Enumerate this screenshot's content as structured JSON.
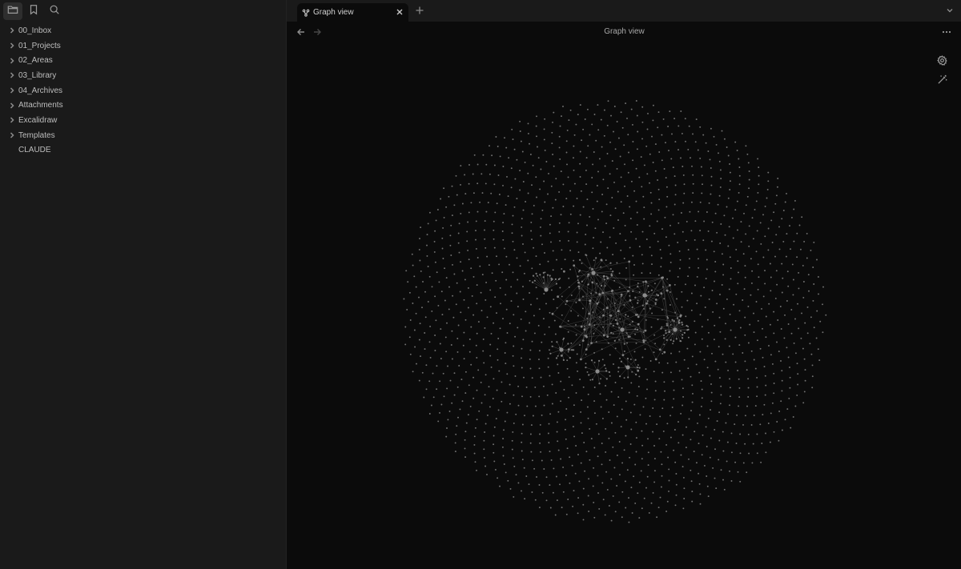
{
  "sidebar": {
    "icons": [
      "folder-icon",
      "bookmark-icon",
      "search-icon"
    ],
    "items": [
      {
        "label": "00_Inbox",
        "type": "folder"
      },
      {
        "label": "01_Projects",
        "type": "folder"
      },
      {
        "label": "02_Areas",
        "type": "folder"
      },
      {
        "label": "03_Library",
        "type": "folder"
      },
      {
        "label": "04_Archives",
        "type": "folder"
      },
      {
        "label": "Attachments",
        "type": "folder"
      },
      {
        "label": "Excalidraw",
        "type": "folder"
      },
      {
        "label": "Templates",
        "type": "folder"
      },
      {
        "label": "CLAUDE",
        "type": "file"
      }
    ]
  },
  "tabs": [
    {
      "label": "Graph view",
      "icon": "graph-icon",
      "active": true
    }
  ],
  "view": {
    "title": "Graph view"
  },
  "colors": {
    "background": "#0b0b0b",
    "sidebar": "#1a1a1a",
    "node": "#8c8c8c",
    "edge": "#5a5a5a"
  }
}
